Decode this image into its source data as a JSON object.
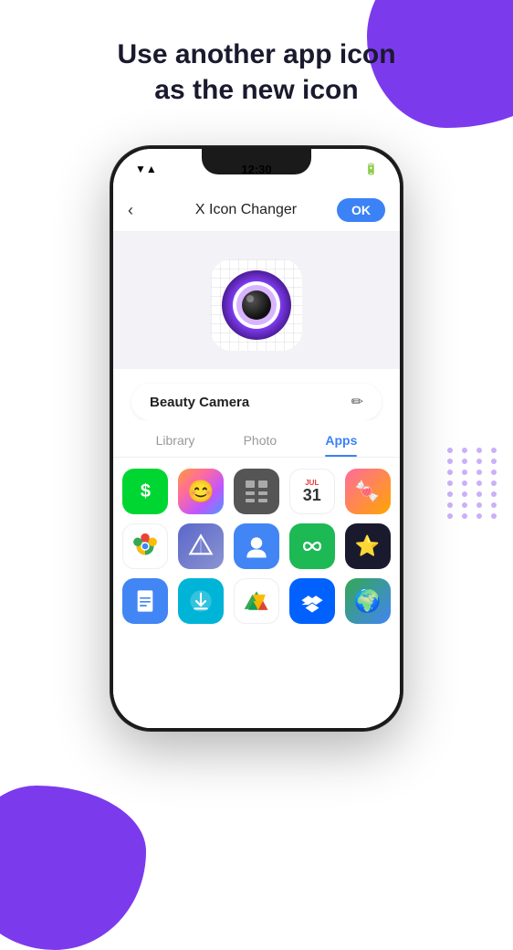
{
  "header": {
    "title": "Use another app icon\nas the new icon"
  },
  "phone": {
    "statusBar": {
      "time": "12:30",
      "signal": "▼▲",
      "battery": "🔋"
    },
    "navBar": {
      "backIcon": "‹",
      "title": "X Icon Changer",
      "okButton": "OK"
    },
    "appName": "Beauty Camera",
    "editIcon": "✏",
    "tabs": [
      {
        "label": "Library",
        "active": false
      },
      {
        "label": "Photo",
        "active": false
      },
      {
        "label": "Apps",
        "active": true
      }
    ],
    "apps": [
      {
        "name": "Cash App",
        "colorClass": "icon-cashapp",
        "symbol": "$"
      },
      {
        "name": "Bitmoji",
        "colorClass": "icon-bitmoji",
        "symbol": "😊"
      },
      {
        "name": "Calculator",
        "colorClass": "icon-calc",
        "symbol": "⊞"
      },
      {
        "name": "Calendar",
        "colorClass": "icon-calendar",
        "symbol": "31"
      },
      {
        "name": "Candy Crush",
        "colorClass": "icon-candy",
        "symbol": "🍬"
      },
      {
        "name": "Chrome",
        "colorClass": "icon-chrome",
        "symbol": "🌐"
      },
      {
        "name": "Prism",
        "colorClass": "icon-prism",
        "symbol": "◈"
      },
      {
        "name": "Contacts",
        "colorClass": "icon-contacts",
        "symbol": "👤"
      },
      {
        "name": "Anagram",
        "colorClass": "icon-anagram",
        "symbol": "∞"
      },
      {
        "name": "Star App",
        "colorClass": "icon-star",
        "symbol": "⭐"
      },
      {
        "name": "Google Docs",
        "colorClass": "icon-docs",
        "symbol": "📄"
      },
      {
        "name": "Downloader",
        "colorClass": "icon-downloader",
        "symbol": "⬇"
      },
      {
        "name": "Google Drive",
        "colorClass": "icon-drive",
        "symbol": "△"
      },
      {
        "name": "Dropbox",
        "colorClass": "icon-dropbox",
        "symbol": "📦"
      },
      {
        "name": "Google Maps",
        "colorClass": "icon-maps",
        "symbol": "🌍"
      }
    ]
  },
  "colors": {
    "purple": "#7c3aed",
    "blue": "#3b82f6",
    "dark": "#1a1a2e",
    "accent": "#7c3aed"
  }
}
